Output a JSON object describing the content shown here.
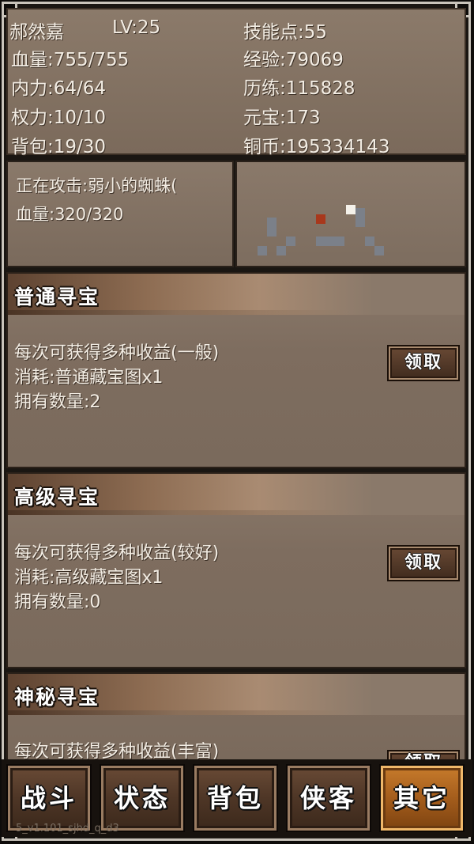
{
  "player": {
    "name": "郝然嘉",
    "level": "LV:25",
    "hp": "血量:755/755",
    "mp": "内力:64/64",
    "authority": "权力:10/10",
    "bag": "背包:19/30",
    "skill_points": "技能点:55",
    "exp": "经验:79069",
    "training": "历练:115828",
    "yuanbao": "元宝:173",
    "copper": "铜币:195334143"
  },
  "target": {
    "attacking": "正在攻击:弱小的蜘蛛(",
    "hp": "血量:320/320"
  },
  "panels": [
    {
      "title": "普通寻宝",
      "desc": "每次可获得多种收益(一般)",
      "cost": "消耗:普通藏宝图x1",
      "owned": "拥有数量:2",
      "button": "领取"
    },
    {
      "title": "高级寻宝",
      "desc": "每次可获得多种收益(较好)",
      "cost": "消耗:高级藏宝图x1",
      "owned": "拥有数量:0",
      "button": "领取"
    },
    {
      "title": "神秘寻宝",
      "desc": "每次可获得多种收益(丰富)",
      "button": "领取"
    }
  ],
  "tabs": {
    "battle": "战斗",
    "status": "状态",
    "bag": "背包",
    "companions": "侠客",
    "other": "其它",
    "active": "other"
  },
  "version": "5_v1.101_sjhd_q_d3",
  "colors": {
    "panel": "#7e6d5f",
    "active_tab": "#a45d1c",
    "player_marker": "#f4f1ea",
    "enemy_marker": "#a8381c",
    "map_tile": "#7b8089"
  }
}
